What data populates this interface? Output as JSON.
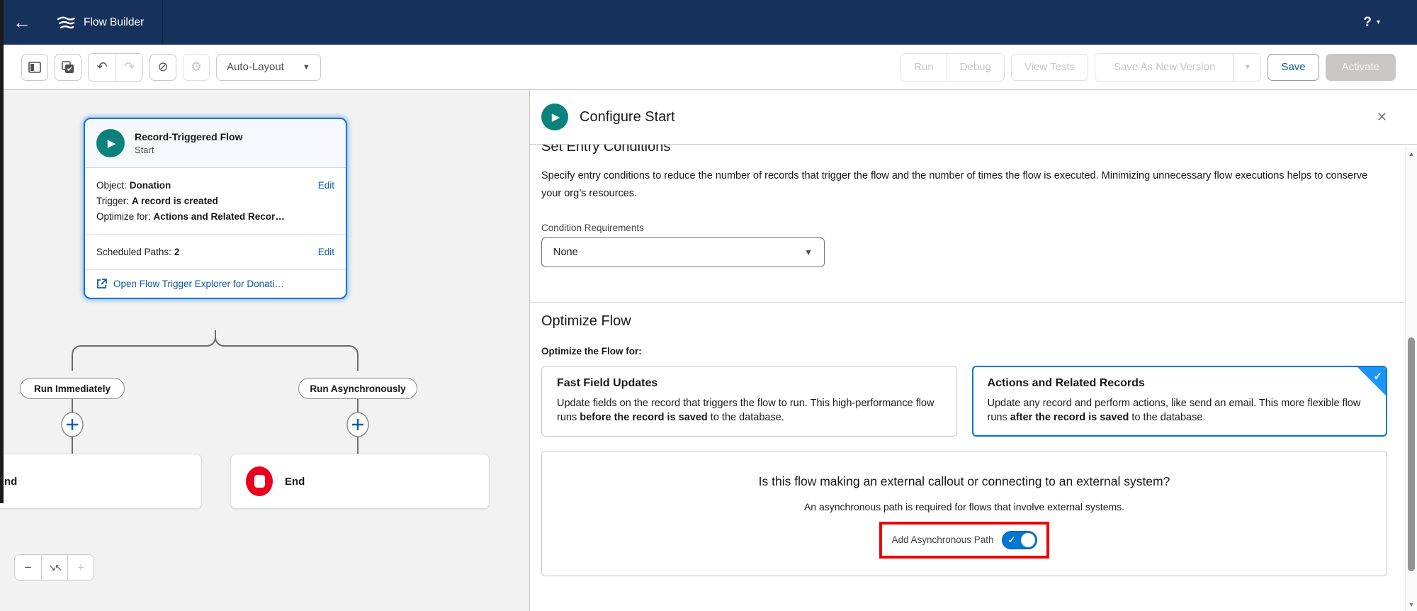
{
  "navbar": {
    "app_title": "Flow Builder",
    "help_label": "?"
  },
  "icons": {
    "back": "←",
    "caret_down": "▼",
    "caret_small": "▾",
    "undo": "↶",
    "redo": "↷",
    "disable": "⊘",
    "gear": "⚙",
    "minus": "−",
    "plus": "+",
    "fit": "↘↖",
    "close": "✕",
    "check": "✓",
    "play": "▶",
    "scroll_up": "▲",
    "scroll_down": "▼"
  },
  "toolbar": {
    "auto_layout_label": "Auto-Layout",
    "run_label": "Run",
    "debug_label": "Debug",
    "view_tests_label": "View Tests",
    "save_as_new_version_label": "Save As New Version",
    "save_label": "Save",
    "activate_label": "Activate"
  },
  "canvas": {
    "start_card": {
      "type": "Record-Triggered Flow",
      "subtitle": "Start",
      "object_label": "Object:",
      "object_value": "Donation",
      "edit_label": "Edit",
      "trigger_label": "Trigger:",
      "trigger_value": "A record is created",
      "optimize_label": "Optimize for:",
      "optimize_value": "Actions and Related Recor…",
      "scheduled_label": "Scheduled Paths:",
      "scheduled_value": "2",
      "scheduled_edit_label": "Edit",
      "explorer_link": "Open Flow Trigger Explorer for Donati…"
    },
    "branches": {
      "left_label": "Run Immediately",
      "right_label": "Run Asynchronously"
    },
    "end_left_label": "End",
    "end_right_label": "End"
  },
  "panel": {
    "title": "Configure Start",
    "entry": {
      "heading": "Set Entry Conditions",
      "description": "Specify entry conditions to reduce the number of records that trigger the flow and the number of times the flow is executed. Minimizing unnecessary flow executions helps to conserve your org’s resources.",
      "condition_label": "Condition Requirements",
      "condition_value": "None"
    },
    "optimize": {
      "heading": "Optimize Flow",
      "sub_label": "Optimize the Flow for:",
      "options": [
        {
          "title": "Fast Field Updates",
          "desc_pre": "Update fields on the record that triggers the flow to run. This high-performance flow runs ",
          "desc_bold": "before the record is saved",
          "desc_post": " to the database.",
          "selected": false
        },
        {
          "title": "Actions and Related Records",
          "desc_pre": "Update any record and perform actions, like send an email. This more flexible flow runs ",
          "desc_bold": "after the record is saved",
          "desc_post": " to the database.",
          "selected": true
        }
      ]
    },
    "callout": {
      "question": "Is this flow making an external callout or connecting to an external system?",
      "note": "An asynchronous path is required for flows that involve external systems.",
      "toggle_label": "Add Asynchronous Path",
      "toggle_on": true
    },
    "colors": {
      "accent_blue": "#0176d3",
      "link_blue": "#0b5cab",
      "navy": "#16325c",
      "teal": "#0b827c",
      "end_red": "#ea001e",
      "highlight_red": "#ee0000"
    }
  }
}
